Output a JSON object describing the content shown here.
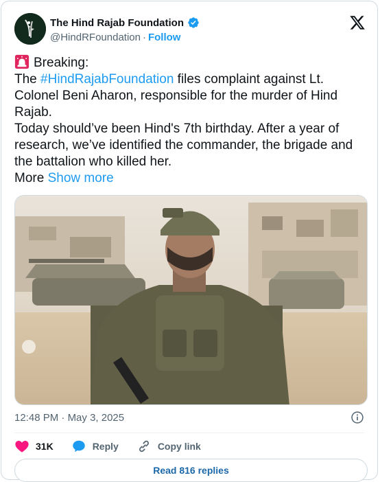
{
  "account": {
    "name": "The Hind Rajab Foundation",
    "handle": "@HindRFoundation",
    "separator": "·",
    "follow_label": "Follow"
  },
  "post": {
    "line1": "Breaking:",
    "line2_prefix": "The ",
    "hashtag": "#HindRajabFoundation",
    "line2_suffix": " files complaint against Lt. Colonel Beni Aharon, responsible for the murder of Hind Rajab.",
    "line3": "Today should’ve been Hind's 7th birthday. After a year of research, we’ve identified the commander, the brigade and the battalion who killed her.",
    "more_prefix": "More",
    "show_more": "Show more"
  },
  "meta": {
    "time": "12:48 PM",
    "separator": "·",
    "date": "May 3, 2025"
  },
  "actions": {
    "likes": "31K",
    "reply_label": "Reply",
    "copy_link_label": "Copy link"
  },
  "read_replies_label": "Read 816 replies",
  "colors": {
    "accent": "#1d9bf0",
    "like": "#f91880",
    "text": "#0f1419",
    "muted": "#536471",
    "border": "#cfd9de"
  },
  "icons": [
    "verified-badge-icon",
    "x-logo-icon",
    "siren-icon",
    "info-icon",
    "heart-icon",
    "reply-bubble-icon",
    "link-icon"
  ]
}
